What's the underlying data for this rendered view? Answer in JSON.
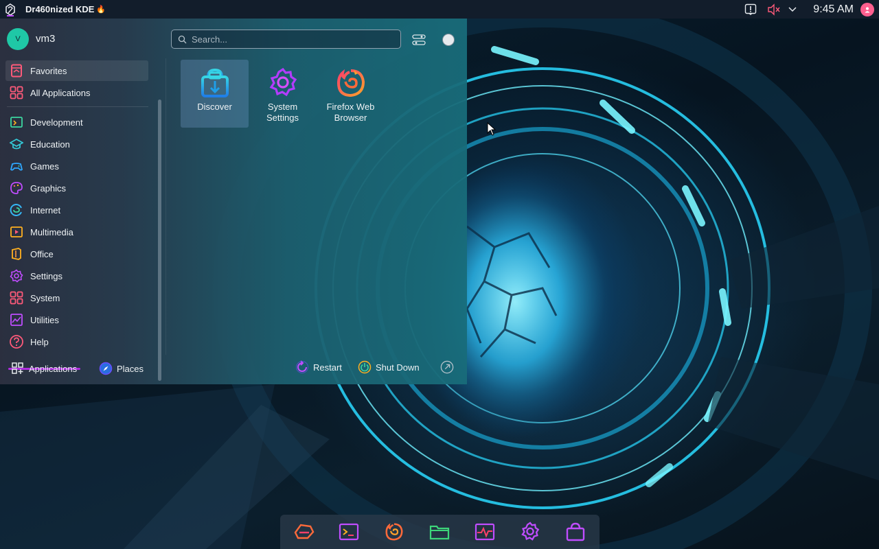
{
  "top_panel": {
    "title": "Dr460nized KDE",
    "title_emoji": "🔥",
    "clock": "9:45 AM",
    "tray_icons": [
      "notification-icon",
      "volume-muted-icon",
      "chevron-down-icon",
      "user-avatar-icon"
    ]
  },
  "launcher": {
    "user": {
      "initial": "V",
      "name": "vm3"
    },
    "search": {
      "placeholder": "Search..."
    },
    "categories": [
      {
        "label": "Favorites",
        "icon": "bookmark-icon",
        "color": "#ff5a7a",
        "active": true
      },
      {
        "label": "All Applications",
        "icon": "grid-icon",
        "color": "#ff5a7a"
      },
      {
        "label": "Development",
        "icon": "development-icon",
        "color": "#3dd6a0"
      },
      {
        "label": "Education",
        "icon": "graduation-cap-icon",
        "color": "#33c8d6"
      },
      {
        "label": "Games",
        "icon": "gamepad-icon",
        "color": "#2fa8ff"
      },
      {
        "label": "Graphics",
        "icon": "palette-icon",
        "color": "#c04dff"
      },
      {
        "label": "Internet",
        "icon": "globe-icon",
        "color": "#35b6f5"
      },
      {
        "label": "Multimedia",
        "icon": "multimedia-icon",
        "color": "#ff9a3c"
      },
      {
        "label": "Office",
        "icon": "office-icon",
        "color": "#ffb020"
      },
      {
        "label": "Settings",
        "icon": "gear-icon",
        "color": "#c04dff"
      },
      {
        "label": "System",
        "icon": "system-icon",
        "color": "#ff5a7a"
      },
      {
        "label": "Utilities",
        "icon": "utilities-icon",
        "color": "#c04dff"
      },
      {
        "label": "Help",
        "icon": "help-icon",
        "color": "#ff5a7a"
      }
    ],
    "apps": [
      {
        "label": "Discover",
        "icon": "discover-icon",
        "active": true
      },
      {
        "label": "System Settings",
        "icon": "system-settings-icon"
      },
      {
        "label": "Firefox Web Browser",
        "icon": "firefox-icon"
      }
    ],
    "footer": {
      "applications": "Applications",
      "places": "Places",
      "restart": "Restart",
      "shutdown": "Shut Down"
    }
  },
  "dock": {
    "items": [
      "garuda-icon",
      "terminal-icon",
      "firefox-icon",
      "files-icon",
      "system-monitor-icon",
      "settings-icon",
      "store-icon"
    ]
  },
  "colors": {
    "accent_pink": "#ff5a7a",
    "accent_purple": "#c04dff",
    "accent_cyan": "#33c8d6",
    "panel_bg": "#121d2b"
  }
}
